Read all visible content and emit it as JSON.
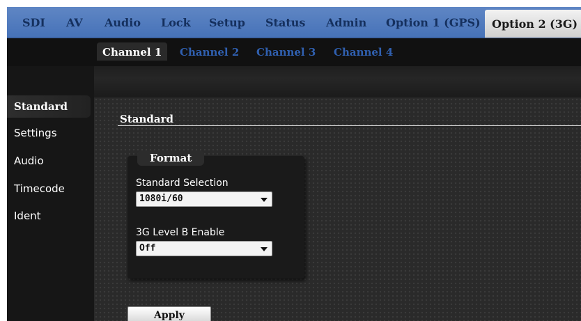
{
  "top_tabs": [
    {
      "label": "SDI"
    },
    {
      "label": "AV"
    },
    {
      "label": "Audio"
    },
    {
      "label": "Lock"
    },
    {
      "label": "Setup"
    },
    {
      "label": "Status"
    },
    {
      "label": "Admin"
    },
    {
      "label": "Option 1 (GPS)"
    },
    {
      "label": "Option 2 (3G)",
      "active": true
    }
  ],
  "channel_tabs": [
    {
      "label": "Channel 1",
      "active": true
    },
    {
      "label": "Channel 2"
    },
    {
      "label": "Channel 3"
    },
    {
      "label": "Channel 4"
    }
  ],
  "sidebar": {
    "items": [
      {
        "label": "Standard",
        "active": true
      },
      {
        "label": "Settings"
      },
      {
        "label": "Audio"
      },
      {
        "label": "Timecode"
      },
      {
        "label": "Ident"
      }
    ]
  },
  "content": {
    "section_title": "Standard",
    "group_title": "Format",
    "fields": [
      {
        "label": "Standard Selection",
        "value": "1080i/60"
      },
      {
        "label": "3G Level B Enable",
        "value": "Off"
      }
    ],
    "apply_label": "Apply"
  },
  "colors": {
    "topnav": "#4672b8",
    "topnav_text": "#15305e",
    "channel_inactive": "#3060b0"
  }
}
